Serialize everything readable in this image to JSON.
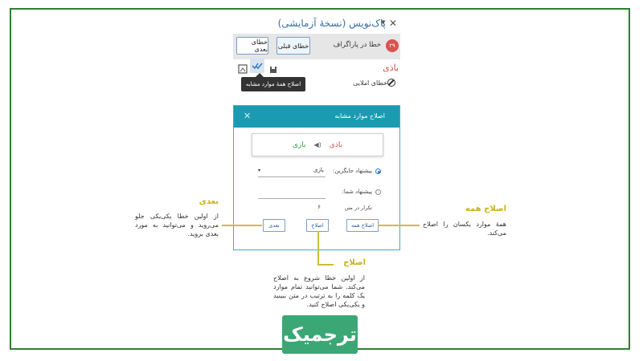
{
  "pane": {
    "title": "پاک‌نویس (نسخهٔ آزمایشی)",
    "close_glyph": "✕",
    "menu_glyph": "▼",
    "error_count": "۲۹",
    "errors_label": "خطا در پاراگراف",
    "prev_label": "خطای قبلی",
    "next_label": "خطای بعدی",
    "word": "باذی",
    "error_type": "خطای املایی",
    "tooltip": "اصلاح همهٔ موارد مشابه"
  },
  "dialog": {
    "title": "اصلاح موارد مشابه",
    "close_glyph": "✕",
    "wrong_word": "باذی",
    "correct_word": "بازی",
    "suggest_label": "پیشنهاد جایگزین:",
    "suggest_value": "بازی",
    "custom_label": "پیشنهاد شما:",
    "repeat_label": "تکرار در متن",
    "repeat_count": "۶",
    "fix_all_label": "اصلاح همه",
    "fix_label": "اصلاح",
    "next_label": "بعدی"
  },
  "callouts": {
    "next_title": "بعدی",
    "next_text": "از اولین خطا یکی‌یکی جلو می‌روید و می‌توانید به مورد بعدی بروید.",
    "fix_title": "اصلاح",
    "fix_text": "از اولین خطا شروع به اصلاح می‌کند. شما می‌توانید تمام موارد یک کلمه را به ترتیب در متن ببینید و یکی‌یکی اصلاح کنید.",
    "fix_all_title": "اصلاح همه",
    "fix_all_text": "همهٔ موارد یکسان را اصلاح می‌کند."
  },
  "logo": {
    "text": "ترجمیک"
  },
  "colors": {
    "frame": "#2f7d2e",
    "accent": "#1b9bb2",
    "callout": "#c9b31e",
    "logo": "#3ba775",
    "error": "#d0504a"
  }
}
